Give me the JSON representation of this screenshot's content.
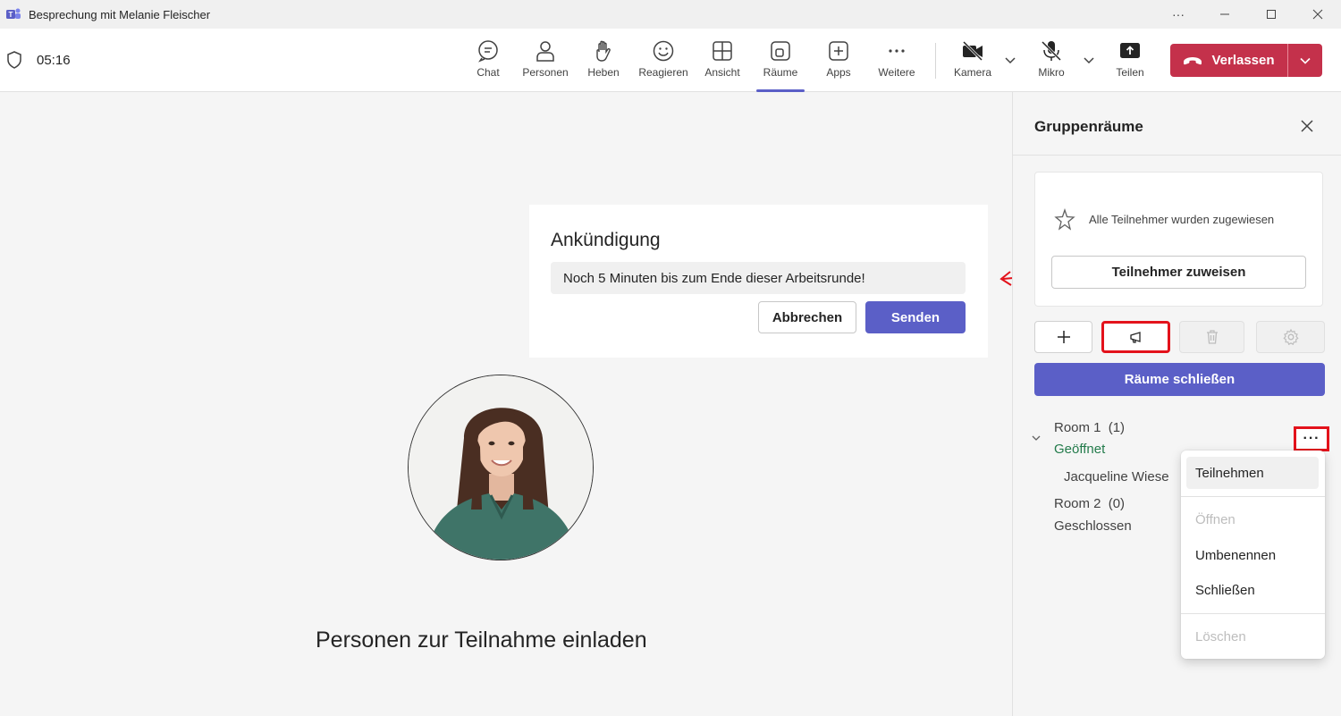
{
  "window": {
    "title": "Besprechung mit Melanie Fleischer",
    "controls": [
      "more-icon",
      "minimize-icon",
      "maximize-icon",
      "close-icon"
    ]
  },
  "toolbar": {
    "timer": "05:16",
    "items": [
      {
        "label": "Chat",
        "icon": "chat-icon"
      },
      {
        "label": "Personen",
        "icon": "people-icon"
      },
      {
        "label": "Heben",
        "icon": "raise-hand-icon"
      },
      {
        "label": "Reagieren",
        "icon": "emoji-icon"
      },
      {
        "label": "Ansicht",
        "icon": "view-icon"
      },
      {
        "label": "Räume",
        "icon": "rooms-icon",
        "active": true
      },
      {
        "label": "Apps",
        "icon": "apps-icon"
      },
      {
        "label": "Weitere",
        "icon": "more-icon"
      },
      {
        "label": "Kamera",
        "icon": "camera-off-icon"
      },
      {
        "label": "Mikro",
        "icon": "mic-off-icon"
      },
      {
        "label": "Teilen",
        "icon": "share-icon"
      }
    ],
    "leave_label": "Verlassen",
    "leave_color": "#c4314b",
    "accent_color": "#5b5fc7"
  },
  "announcement": {
    "title": "Ankündigung",
    "message": "Noch 5 Minuten bis zum Ende dieser Arbeitsrunde!",
    "cancel_label": "Abbrechen",
    "send_label": "Senden"
  },
  "stage": {
    "invite_text": "Personen zur Teilnahme einladen"
  },
  "panel": {
    "title": "Gruppenräume",
    "assigned_info": "Alle Teilnehmer wurden zugewiesen",
    "assign_button": "Teilnehmer zuweisen",
    "close_rooms_button": "Räume schließen",
    "rooms": [
      {
        "name": "Room 1",
        "count": "(1)",
        "status": "Geöffnet",
        "status_color": "#237b4b",
        "participants": [
          "Jacqueline Wiese"
        ]
      },
      {
        "name": "Room 2",
        "count": "(0)",
        "status": "Geschlossen",
        "status_color": "#424242",
        "participants": []
      }
    ]
  },
  "context_menu": {
    "items": [
      {
        "label": "Teilnehmen",
        "disabled": false
      },
      {
        "label": "Öffnen",
        "disabled": true
      },
      {
        "label": "Umbenennen",
        "disabled": false
      },
      {
        "label": "Schließen",
        "disabled": false
      },
      {
        "label": "Löschen",
        "disabled": true
      }
    ]
  }
}
